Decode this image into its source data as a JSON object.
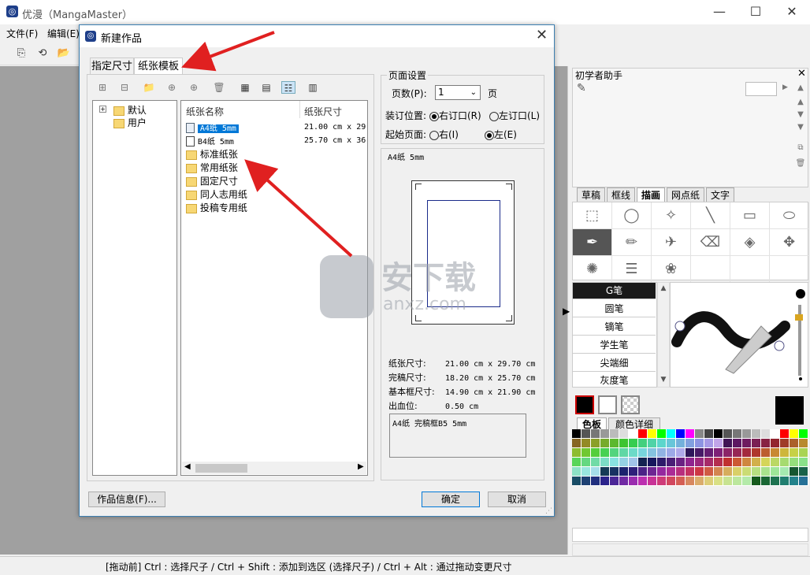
{
  "app": {
    "title": "优漫（MangaMaster）",
    "menu": [
      "文件(F)",
      "编辑(E)"
    ]
  },
  "window_controls": {
    "minimize": "—",
    "maximize": "☐",
    "close": "✕"
  },
  "dialog": {
    "title": "新建作品",
    "tabs": [
      "指定尺寸",
      "纸张模板"
    ],
    "tree": {
      "items": [
        "默认",
        "用户"
      ]
    },
    "list": {
      "headers": [
        "纸张名称",
        "纸张尺寸"
      ],
      "rows": [
        {
          "name": "A4纸 5mm",
          "size": "21.00 cm x 29"
        },
        {
          "name": "B4纸 5mm",
          "size": "25.70 cm x 36"
        },
        {
          "name": "标准纸张",
          "size": ""
        },
        {
          "name": "常用纸张",
          "size": ""
        },
        {
          "name": "固定尺寸",
          "size": ""
        },
        {
          "name": "同人志用纸",
          "size": ""
        },
        {
          "name": "投稿专用纸",
          "size": ""
        }
      ]
    },
    "page_settings": {
      "title": "页面设置",
      "count_label": "页数(P):",
      "count_value": "1",
      "count_unit": "页",
      "binding_label": "装订位置:",
      "binding_right": "右订口(R)",
      "binding_left": "左订口(L)",
      "start_label": "起始页面:",
      "start_right": "右(I)",
      "start_left": "左(E)"
    },
    "preview": {
      "label": "A4纸 5mm",
      "specs": [
        {
          "k": "纸张尺寸:",
          "v": "21.00 cm x 29.70 cm"
        },
        {
          "k": "完稿尺寸:",
          "v": "18.20 cm x 25.70 cm"
        },
        {
          "k": "基本框尺寸:",
          "v": "14.90 cm x 21.90 cm"
        },
        {
          "k": "出血位:",
          "v": "0.50 cm"
        }
      ],
      "memo": "A4纸 完稿框B5 5mm"
    },
    "buttons": {
      "info": "作品信息(F)...",
      "ok": "确定",
      "cancel": "取消"
    }
  },
  "right_panel": {
    "helper_title": "初学者助手",
    "tool_tabs": [
      "草稿",
      "框线",
      "描画",
      "网点纸",
      "文字"
    ],
    "pens": [
      "G笔",
      "圆笔",
      "镝笔",
      "学生笔",
      "尖端细",
      "灰度笔"
    ],
    "color_tabs": [
      "色板",
      "颜色详细"
    ]
  },
  "status": {
    "text": "[拖动前] Ctrl : 选择尺子 / Ctrl + Shift : 添加到选区 (选择尺子)  / Ctrl + Alt : 通过拖动变更尺寸"
  },
  "watermark": {
    "cn": "安下载",
    "en": "anxz.com"
  },
  "colors": {
    "accent": "#0078d7",
    "arrow": "#e02020"
  }
}
